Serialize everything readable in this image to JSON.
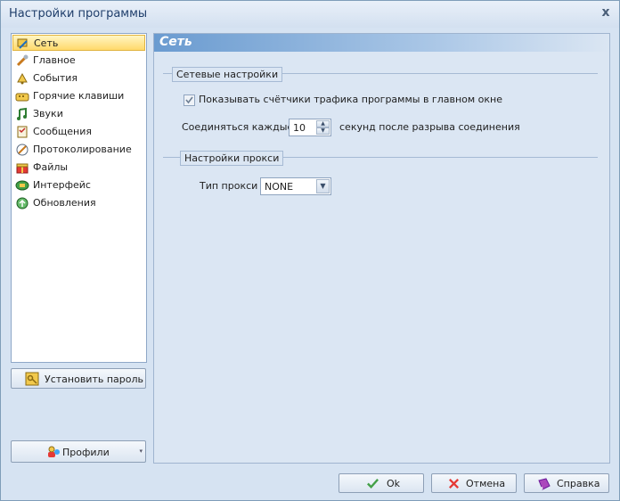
{
  "window": {
    "title": "Настройки программы",
    "close_glyph": "x"
  },
  "nav": {
    "items": [
      {
        "label": "Сеть",
        "icon": "network-icon",
        "selected": true
      },
      {
        "label": "Главное",
        "icon": "wrench-icon"
      },
      {
        "label": "События",
        "icon": "bell-icon"
      },
      {
        "label": "Горячие клавиши",
        "icon": "keyboard-icon"
      },
      {
        "label": "Звуки",
        "icon": "music-note-icon"
      },
      {
        "label": "Сообщения",
        "icon": "message-icon"
      },
      {
        "label": "Протоколирование",
        "icon": "log-pen-icon"
      },
      {
        "label": "Файлы",
        "icon": "gift-file-icon"
      },
      {
        "label": "Интерфейс",
        "icon": "interface-icon"
      },
      {
        "label": "Обновления",
        "icon": "update-icon"
      }
    ]
  },
  "sidebar_buttons": {
    "set_password": "Установить пароль",
    "profiles": "Профили"
  },
  "panel": {
    "title": "Сеть",
    "network_group": "Сетевые настройки",
    "show_counters_label": "Показывать счётчики трафика программы в главном окне",
    "show_counters_checked": true,
    "reconnect_prefix": "Соединяться каждые",
    "reconnect_value": "10",
    "reconnect_suffix": "секунд после разрыва соединения",
    "proxy_group": "Настройки прокси",
    "proxy_type_label": "Тип прокси",
    "proxy_type_value": "NONE"
  },
  "footer": {
    "ok": "Ok",
    "cancel": "Отмена",
    "help": "Справка"
  },
  "colors": {
    "accent": "#6a9bd0",
    "selection": "#ffd96b"
  }
}
